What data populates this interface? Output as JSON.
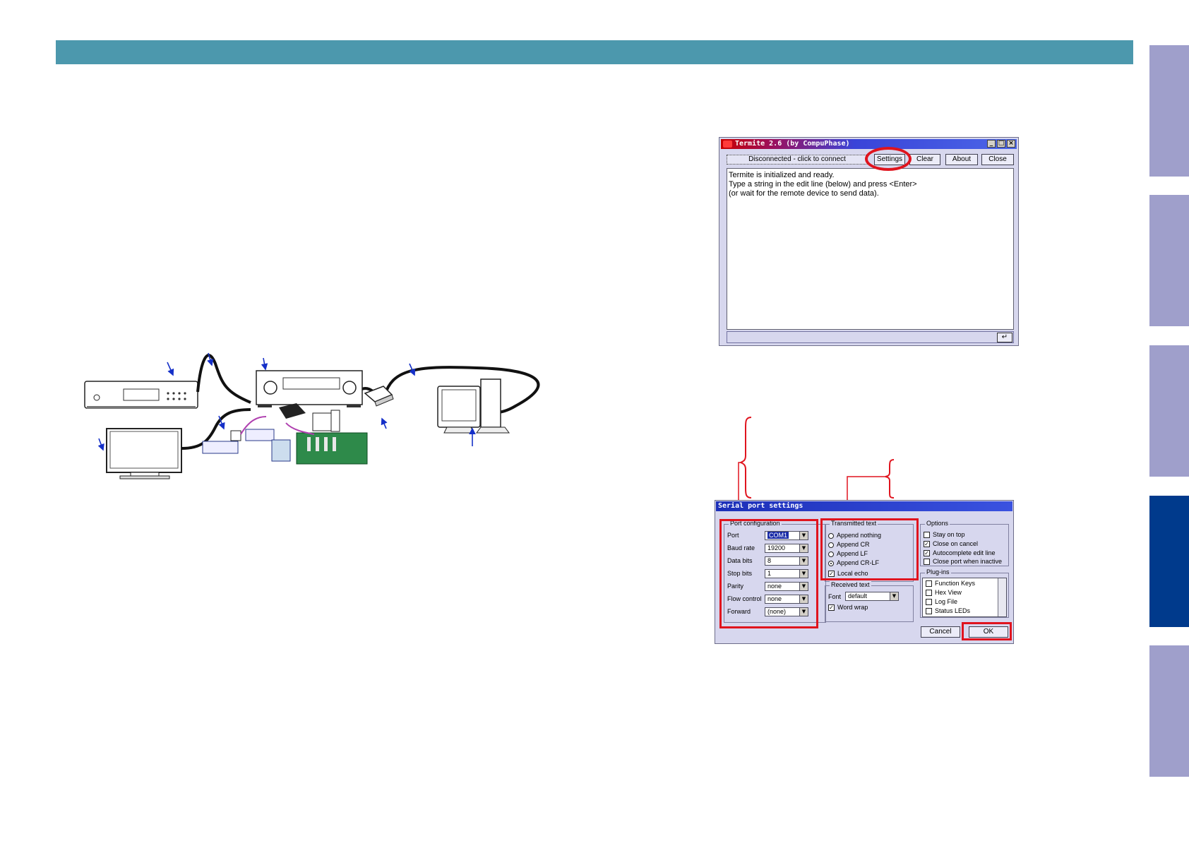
{
  "side_tabs": [
    {
      "state": "inactive"
    },
    {
      "state": "inactive"
    },
    {
      "state": "inactive"
    },
    {
      "state": "active"
    },
    {
      "state": "inactive"
    }
  ],
  "colors": {
    "header": "#4c98ad",
    "tab_inactive": "#9f9fcb",
    "tab_active": "#003a8c",
    "highlight": "#e0141e",
    "arrow": "#1530c8"
  },
  "termite": {
    "title": "Termite 2.6 (by CompuPhase)",
    "status": "Disconnected - click to connect",
    "buttons": {
      "settings": "Settings",
      "clear": "Clear",
      "about": "About",
      "close": "Close"
    },
    "lines": [
      "Termite is initialized and ready.",
      "Type a string in the edit line (below) and press <Enter>",
      "(or wait for the remote device to send data)."
    ],
    "enter_glyph": "↵"
  },
  "serial": {
    "title": "Serial port settings",
    "port_config": {
      "title": "Port configuration",
      "fields": [
        {
          "label": "Port",
          "value": "COM1"
        },
        {
          "label": "Baud rate",
          "value": "19200"
        },
        {
          "label": "Data bits",
          "value": "8"
        },
        {
          "label": "Stop bits",
          "value": "1"
        },
        {
          "label": "Parity",
          "value": "none"
        },
        {
          "label": "Flow control",
          "value": "none"
        },
        {
          "label": "Forward",
          "value": "(none)"
        }
      ]
    },
    "transmitted": {
      "title": "Transmitted text",
      "options": [
        "Append nothing",
        "Append CR",
        "Append LF",
        "Append CR-LF"
      ],
      "local_echo": "Local echo"
    },
    "received": {
      "title": "Received text",
      "font_label": "Font",
      "font_value": "default",
      "word_wrap": "Word wrap"
    },
    "options": {
      "title": "Options",
      "items": [
        "Stay on top",
        "Close on cancel",
        "Autocomplete edit line",
        "Close port when inactive"
      ]
    },
    "plugins": {
      "title": "Plug-ins",
      "items": [
        "Function Keys",
        "Hex View",
        "Log File",
        "Status LEDs"
      ]
    },
    "buttons": {
      "cancel": "Cancel",
      "ok": "OK"
    }
  }
}
